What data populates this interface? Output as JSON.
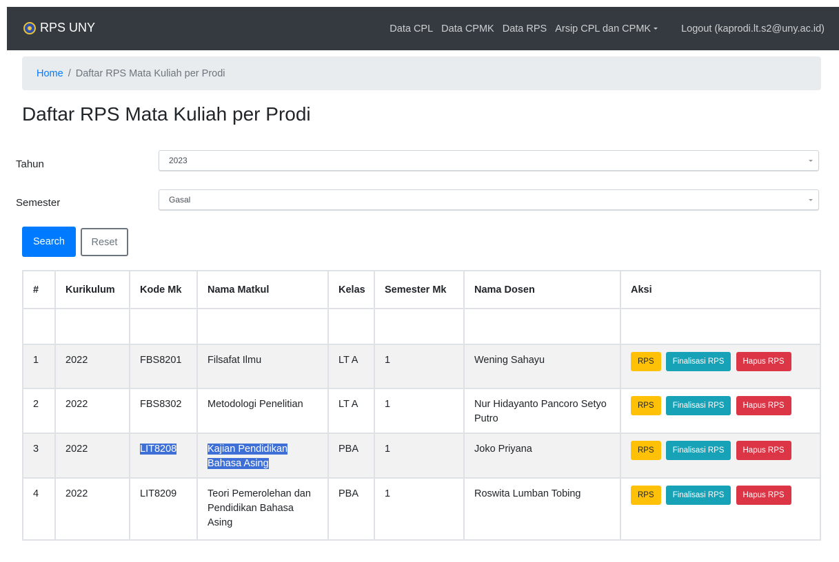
{
  "navbar": {
    "brand": "RPS UNY",
    "items": [
      "Data CPL",
      "Data CPMK",
      "Data RPS",
      "Arsip CPL dan CPMK"
    ],
    "logout": "Logout (kaprodi.lt.s2@uny.ac.id)"
  },
  "breadcrumb": {
    "home": "Home",
    "current": "Daftar RPS Mata Kuliah per Prodi"
  },
  "page_title": "Daftar RPS Mata Kuliah per Prodi",
  "form": {
    "tahun_label": "Tahun",
    "tahun_value": "2023",
    "semester_label": "Semester",
    "semester_value": "Gasal",
    "search_label": "Search",
    "reset_label": "Reset"
  },
  "table": {
    "headers": [
      "#",
      "Kurikulum",
      "Kode Mk",
      "Nama Matkul",
      "Kelas",
      "Semester Mk",
      "Nama Dosen",
      "Aksi"
    ],
    "rows": [
      {
        "no": "1",
        "kurikulum": "2022",
        "kode": "FBS8201",
        "nama": "Filsafat Ilmu",
        "kelas": "LT A",
        "semester": "1",
        "dosen": "Wening Sahayu"
      },
      {
        "no": "2",
        "kurikulum": "2022",
        "kode": "FBS8302",
        "nama": "Metodologi Penelitian",
        "kelas": "LT A",
        "semester": "1",
        "dosen": "Nur Hidayanto Pancoro Setyo Putro"
      },
      {
        "no": "3",
        "kurikulum": "2022",
        "kode": "LIT8208",
        "nama": "Kajian Pendidikan Bahasa Asing",
        "kelas": "PBA",
        "semester": "1",
        "dosen": "Joko Priyana"
      },
      {
        "no": "4",
        "kurikulum": "2022",
        "kode": "LIT8209",
        "nama": "Teori Pemerolehan dan Pendidikan Bahasa Asing",
        "kelas": "PBA",
        "semester": "1",
        "dosen": "Roswita Lumban Tobing"
      }
    ],
    "actions": {
      "rps": "RPS",
      "finalisasi": "Finalisasi RPS",
      "hapus": "Hapus RPS"
    }
  },
  "colors": {
    "navbar": "#343a40",
    "primary": "#007bff",
    "warning": "#ffc107",
    "info": "#17a2b8",
    "danger": "#dc3545",
    "selection": "#3d6fd6"
  }
}
